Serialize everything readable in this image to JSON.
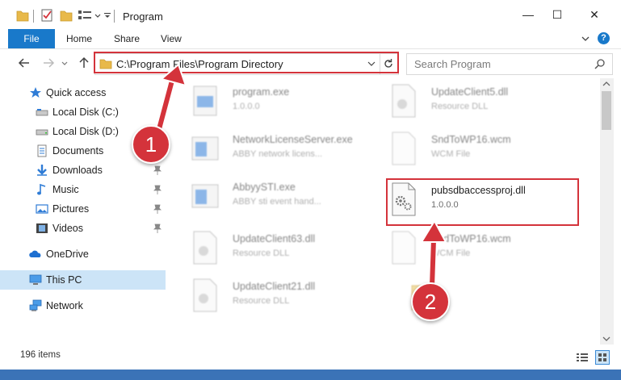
{
  "window": {
    "title": "Program",
    "controls": {
      "minimize": "—",
      "maximize": "☐",
      "close": "✕"
    }
  },
  "ribbon": {
    "tabs": [
      {
        "label": "File"
      },
      {
        "label": "Home"
      },
      {
        "label": "Share"
      },
      {
        "label": "View"
      }
    ],
    "help": "?"
  },
  "navigation": {
    "address": "C:\\Program Files\\Program Directory",
    "search_placeholder": "Search Program"
  },
  "sidebar": {
    "items": [
      {
        "label": "Quick access",
        "icon": "star-icon"
      },
      {
        "label": "Local Disk (C:)",
        "icon": "drive-icon"
      },
      {
        "label": "Local Disk (D:)",
        "icon": "drive-icon"
      },
      {
        "label": "Documents",
        "icon": "documents-icon",
        "pinned": true
      },
      {
        "label": "Downloads",
        "icon": "download-icon",
        "pinned": true
      },
      {
        "label": "Music",
        "icon": "music-icon",
        "pinned": true
      },
      {
        "label": "Pictures",
        "icon": "pictures-icon",
        "pinned": true
      },
      {
        "label": "Videos",
        "icon": "videos-icon",
        "pinned": true
      },
      {
        "label": "OneDrive",
        "icon": "cloud-icon"
      },
      {
        "label": "This PC",
        "icon": "computer-icon",
        "selected": true
      },
      {
        "label": "Network",
        "icon": "network-icon"
      }
    ]
  },
  "files": [
    {
      "name": "program.exe",
      "meta": "1.0.0.0"
    },
    {
      "name": "UpdateClient5.dll",
      "meta": "Resource DLL"
    },
    {
      "name": "NetworkLicenseServer.exe",
      "meta": "ABBY network licens..."
    },
    {
      "name": "SndToWP16.wcm",
      "meta": "WCM File"
    },
    {
      "name": "AbbyySTI.exe",
      "meta": "ABBY sti event hand..."
    },
    {
      "name": "pubsdbaccessproj.dll",
      "meta": "1.0.0.0"
    },
    {
      "name": "UpdateClient63.dll",
      "meta": "Resource DLL"
    },
    {
      "name": "SndToWP16.wcm",
      "meta": "WCM File"
    },
    {
      "name": "UpdateClient21.dll",
      "meta": "Resource DLL"
    }
  ],
  "status": {
    "item_count": "196 items"
  },
  "callouts": [
    {
      "number": "1"
    },
    {
      "number": "2"
    }
  ],
  "colors": {
    "accent": "#1979ca",
    "highlight": "#d4333b",
    "selected": "#cce4f7"
  }
}
